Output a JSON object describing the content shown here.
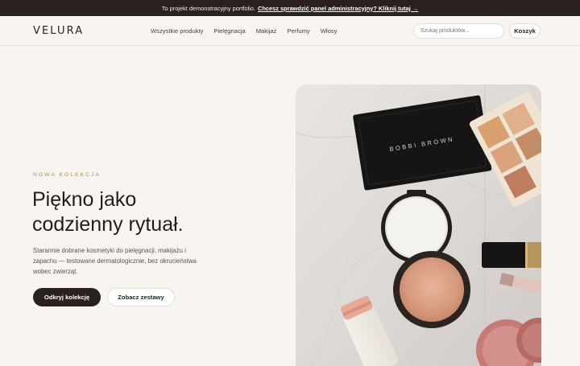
{
  "promo_bar": {
    "text": "To projekt demonstracyjny portfolio.",
    "link": "Chcesz sprawdzić panel administracyjny? Kliknij tutaj →"
  },
  "brand": {
    "logo": "VELURA"
  },
  "nav": {
    "items": [
      "Wszystkie produkty",
      "Pielęgnacja",
      "Makijaż",
      "Perfumy",
      "Włosy"
    ]
  },
  "search": {
    "placeholder": "Szukaj produktów..."
  },
  "cart": {
    "label": "Koszyk"
  },
  "hero": {
    "eyebrow": "NOWA KOLEKCJA",
    "headline_line1": "Piękno jako",
    "headline_line2": "codzienny rytuał.",
    "lead": "Starannie dobrane kosmetyki do pielęgnacji, makijażu i zapachu — testowane dermatologicznie, bez okrucieństwa wobec zwierząt.",
    "primary_button": "Odkryj kolekcję",
    "secondary_button": "Zobacz zestawy",
    "image_brand_text": "BOBBI BROWN"
  },
  "colors": {
    "background": "#f8f5f1",
    "topbar": "#2a201d",
    "accent": "#b68a5e",
    "primary_button": "#2a201d"
  }
}
